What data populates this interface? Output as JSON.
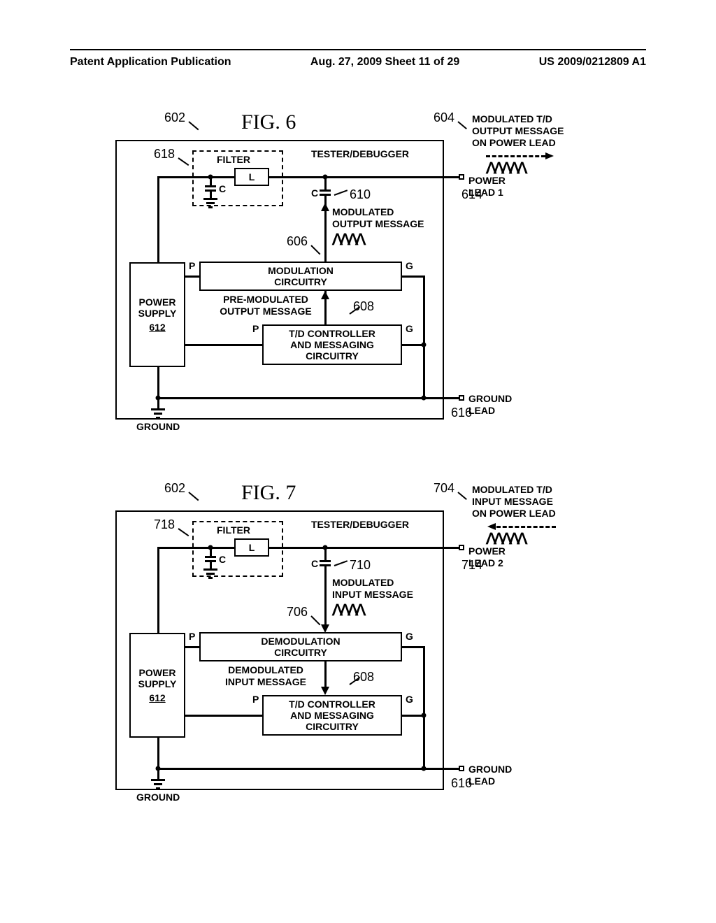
{
  "header": {
    "left": "Patent Application Publication",
    "center": "Aug. 27, 2009  Sheet 11 of 29",
    "right": "US 2009/0212809 A1"
  },
  "fig6": {
    "title": "FIG. 6",
    "refs": {
      "r602": "602",
      "r604": "604",
      "r618": "618",
      "r610": "610",
      "r614": "614",
      "r606": "606",
      "r608": "608",
      "r612": "612",
      "r616": "616"
    },
    "labels": {
      "tester": "TESTER/DEBUGGER",
      "filter": "FILTER",
      "L": "L",
      "C1": "C",
      "C2": "C",
      "modulated_td": "MODULATED T/D\nOUTPUT MESSAGE\nON POWER LEAD",
      "power_lead": "POWER LEAD 1",
      "mod_out": "MODULATED\nOUTPUT MESSAGE",
      "premod": "PRE-MODULATED\nOUTPUT MESSAGE",
      "mod_circ": "MODULATION\nCIRCUITRY",
      "td_ctrl": "T/D CONTROLLER\nAND MESSAGING\nCIRCUITRY",
      "power_supply": "POWER\nSUPPLY",
      "ground_lead": "GROUND LEAD",
      "ground": "GROUND",
      "P": "P",
      "G": "G"
    }
  },
  "fig7": {
    "title": "FIG. 7",
    "refs": {
      "r602": "602",
      "r704": "704",
      "r718": "718",
      "r710": "710",
      "r714": "714",
      "r706": "706",
      "r608": "608",
      "r612": "612",
      "r616": "616"
    },
    "labels": {
      "tester": "TESTER/DEBUGGER",
      "filter": "FILTER",
      "L": "L",
      "C1": "C",
      "C2": "C",
      "modulated_td": "MODULATED T/D\nINPUT MESSAGE\nON POWER LEAD",
      "power_lead": "POWER LEAD 2",
      "mod_in": "MODULATED\nINPUT MESSAGE",
      "demod_msg": "DEMODULATED\nINPUT MESSAGE",
      "demod_circ": "DEMODULATION\nCIRCUITRY",
      "td_ctrl": "T/D CONTROLLER\nAND MESSAGING\nCIRCUITRY",
      "power_supply": "POWER\nSUPPLY",
      "ground_lead": "GROUND LEAD",
      "ground": "GROUND",
      "P": "P",
      "G": "G"
    }
  }
}
